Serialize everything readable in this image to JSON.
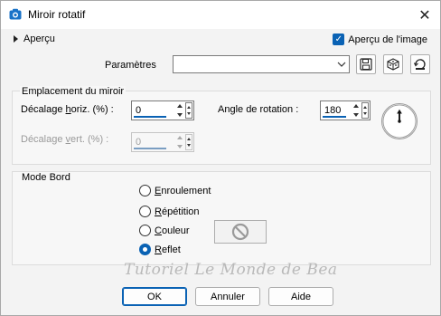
{
  "window": {
    "title": "Miroir rotatif",
    "close_glyph": "✕"
  },
  "preview": {
    "toggle_label": "Aperçu",
    "image_label": "Aperçu de l'image",
    "image_checked": true
  },
  "presets": {
    "label": "Paramètres",
    "value": ""
  },
  "toolbar_icons": [
    "save-icon",
    "randomize-icon",
    "reset-icon"
  ],
  "mirror_group": {
    "title": "Emplacement du miroir",
    "horiz_offset": {
      "label_prefix": "Décalage ",
      "label_underlined": "h",
      "label_suffix": "oriz. (%) :",
      "value": "0"
    },
    "vert_offset": {
      "label_prefix": "Décalage ",
      "label_underlined": "v",
      "label_suffix": "ert. (%) :",
      "value": "0",
      "disabled": true
    },
    "rotation": {
      "label": "Angle de rotation :",
      "value": "180"
    },
    "dial_angle_deg": 180
  },
  "border_group": {
    "title": "Mode Bord",
    "options": [
      {
        "underlined": "E",
        "rest": "nroulement",
        "checked": false
      },
      {
        "underlined": "R",
        "rest": "épétition",
        "checked": false
      },
      {
        "underlined": "C",
        "rest": "ouleur",
        "checked": false
      },
      {
        "underlined": "R",
        "rest": "eflet",
        "checked": true
      }
    ]
  },
  "watermark": "Tutoriel Le Monde de Bea",
  "buttons": {
    "ok": "OK",
    "cancel": "Annuler",
    "help": "Aide"
  },
  "colors": {
    "accent": "#0a62b4",
    "title_icon": "#1a73c8"
  }
}
